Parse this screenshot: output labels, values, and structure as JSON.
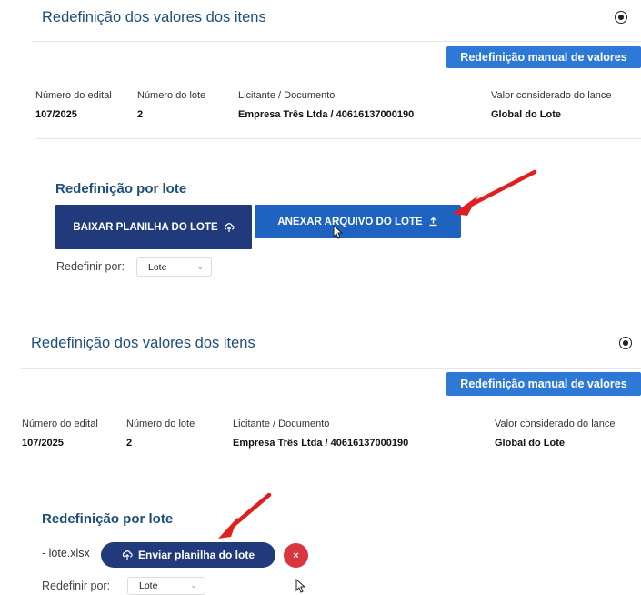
{
  "panel1": {
    "title": "Redefinição dos valores dos itens",
    "manual_button": "Redefinição manual de valores",
    "columns": [
      {
        "label": "Número do edital",
        "value": "107/2025"
      },
      {
        "label": "Número do lote",
        "value": "2"
      },
      {
        "label": "Licitante / Documento",
        "value": "Empresa Três Ltda / 40616137000190"
      },
      {
        "label": "Valor considerado do lance",
        "value": "Global do Lote"
      }
    ],
    "section_title": "Redefinição por lote",
    "download_button": "BAIXAR PLANILHA DO LOTE",
    "attach_button": "ANEXAR ARQUIVO DO LOTE",
    "redefine_label": "Redefinir por:",
    "redefine_value": "Lote"
  },
  "panel2": {
    "title": "Redefinição dos valores dos itens",
    "manual_button": "Redefinição manual de valores",
    "columns": [
      {
        "label": "Número do edital",
        "value": "107/2025"
      },
      {
        "label": "Número do lote",
        "value": "2"
      },
      {
        "label": "Licitante / Documento",
        "value": "Empresa Três Ltda / 40616137000190"
      },
      {
        "label": "Valor considerado do lance",
        "value": "Global do Lote"
      }
    ],
    "section_title": "Redefinição por lote",
    "file_name": "- lote.xlsx",
    "send_button": "Enviar planilha do lote",
    "redefine_label": "Redefinir por:",
    "redefine_value": "Lote"
  },
  "colors": {
    "title": "#1f4e79",
    "manual_button": "#2f79d6",
    "dark_button": "#203a7c",
    "blue_button": "#1e63bf",
    "remove_button": "#d9363e",
    "arrow": "#e02020"
  },
  "icons": [
    "close-circle-icon",
    "upload-cloud-icon",
    "upload-icon",
    "chevron-down-icon",
    "remove-x-icon",
    "red-arrow-annotation",
    "mouse-cursor"
  ]
}
